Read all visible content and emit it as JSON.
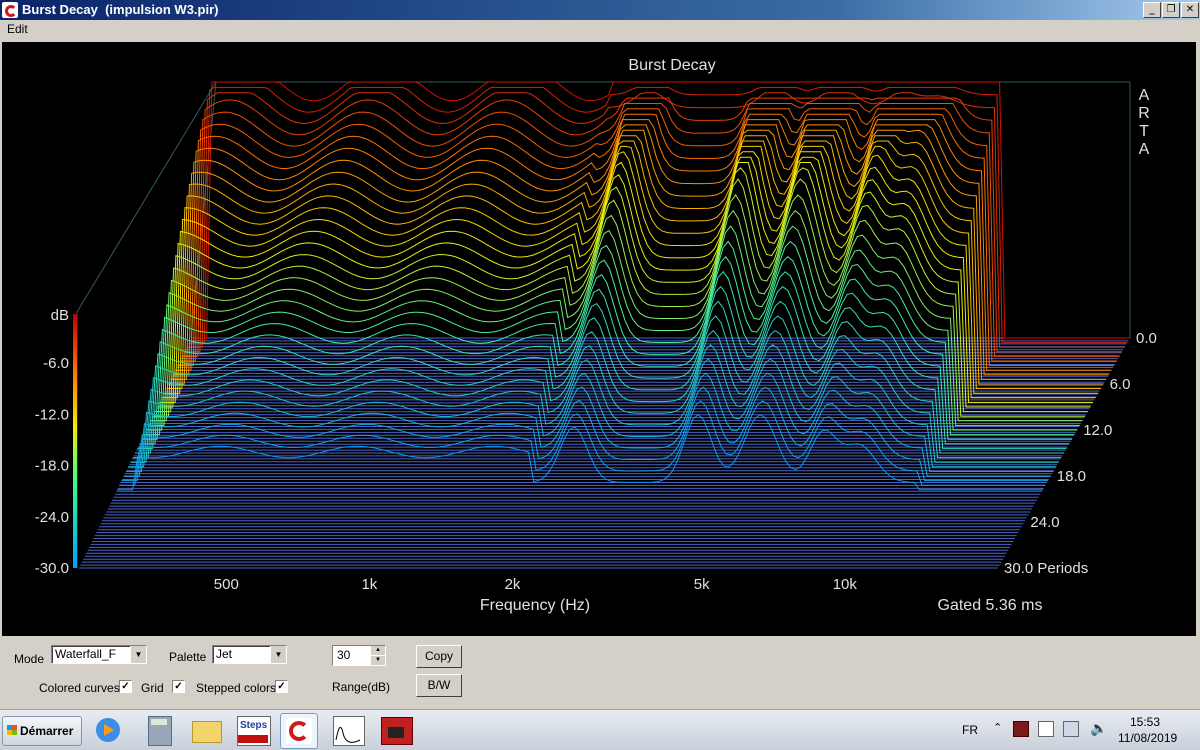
{
  "window": {
    "title": "Burst Decay  (impulsion W3.pir)",
    "minimize": "_",
    "restore": "❐",
    "close": "✕"
  },
  "menu": {
    "edit": "Edit"
  },
  "chart_data": {
    "type": "waterfall",
    "title": "Burst Decay",
    "watermark": [
      "A",
      "R",
      "T",
      "A"
    ],
    "xlabel": "Frequency (Hz)",
    "x_scale": "log",
    "x_ticks": [
      "500",
      "1k",
      "2k",
      "5k",
      "10k"
    ],
    "x_tick_values": [
      500,
      1000,
      2000,
      5000,
      10000
    ],
    "z_unit_label": "dB",
    "z_ticks": [
      "-6.0",
      "-12.0",
      "-18.0",
      "-24.0",
      "-30.0"
    ],
    "z_range": [
      -30,
      0
    ],
    "depth_ticks": [
      "0.0",
      "6.0",
      "12.0",
      "18.0",
      "24.0",
      "30.0 Periods"
    ],
    "depth_range": [
      0,
      30
    ],
    "note": "Gated 5.36 ms",
    "palette": "Jet",
    "colors": {
      "background": "#000000",
      "floor": "#4a62c8",
      "frame": "#2f5d4d"
    }
  },
  "controls": {
    "mode_label": "Mode",
    "mode_value": "Waterfall_F",
    "palette_label": "Palette",
    "palette_value": "Jet",
    "range_value": "30",
    "range_label": "Range(dB)",
    "copy_button": "Copy",
    "bw_button": "B/W",
    "colored_curves_label": "Colored curves",
    "grid_label": "Grid",
    "stepped_colors_label": "Stepped colors",
    "check_mark": "✓",
    "colored_curves_checked": true,
    "grid_checked": true,
    "stepped_colors_checked": true
  },
  "taskbar": {
    "start_label": "Démarrer",
    "steps_label": "Steps",
    "language": "FR",
    "time": "15:53",
    "date": "11/08/2019"
  }
}
